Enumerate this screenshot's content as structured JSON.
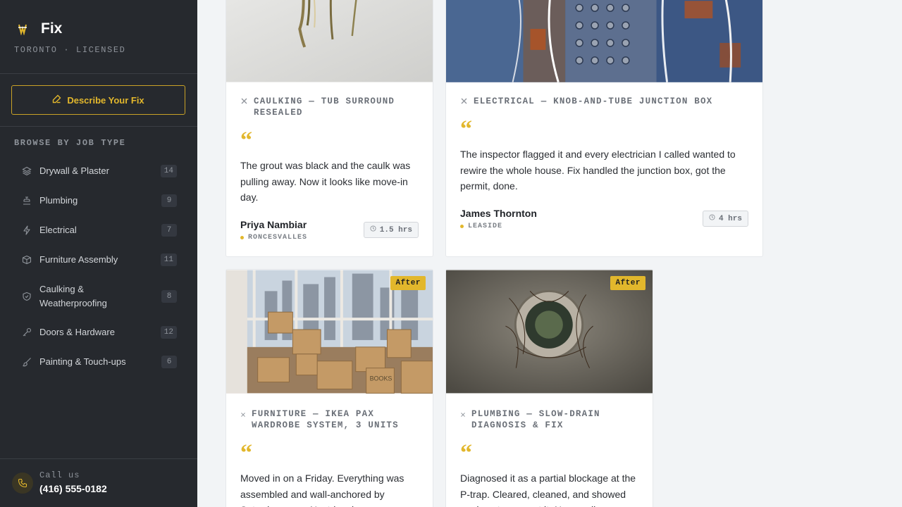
{
  "brand": {
    "name": "Fix",
    "subtitle": "TORONTO · LICENSED",
    "accent": "#e2b72c"
  },
  "cta": {
    "label": "Describe Your Fix",
    "icon": "edit-icon"
  },
  "nav": {
    "title": "BROWSE BY JOB TYPE",
    "items": [
      {
        "label": "Drywall & Plaster",
        "count": "14",
        "icon": "layers-icon"
      },
      {
        "label": "Plumbing",
        "count": "9",
        "icon": "faucet-icon"
      },
      {
        "label": "Electrical",
        "count": "7",
        "icon": "bolt-icon"
      },
      {
        "label": "Furniture Assembly",
        "count": "11",
        "icon": "box-icon"
      },
      {
        "label": "Caulking & Weatherproofing",
        "count": "8",
        "icon": "shield-icon"
      },
      {
        "label": "Doors & Hardware",
        "count": "12",
        "icon": "key-icon"
      },
      {
        "label": "Painting & Touch-ups",
        "count": "6",
        "icon": "brush-icon"
      }
    ]
  },
  "footer": {
    "call_label": "Call us",
    "phone": "(416) 555-0182"
  },
  "cards": [
    {
      "job": "CAULKING — TUB SURROUND RESEALED",
      "quote": "The grout was black and the caulk was pulling away. Now it looks like move-in day.",
      "author": "Priya Nambiar",
      "neighbourhood": "RONCESVALLES",
      "time": "1.5 hrs"
    },
    {
      "job": "ELECTRICAL — KNOB-AND-TUBE JUNCTION BOX",
      "quote": "The inspector flagged it and every electrician I called wanted to rewire the whole house. Fix handled the junction box, got the permit, done.",
      "author": "James Thornton",
      "neighbourhood": "LEASIDE",
      "time": "4 hrs"
    },
    {
      "badge": "After",
      "job": "FURNITURE — IKEA PAX WARDROBE SYSTEM, 3 UNITS",
      "quote": "Moved in on a Friday. Everything was assembled and wall-anchored by Saturday noon. Next-level",
      "box_label": "BOOKS"
    },
    {
      "badge": "After",
      "job": "PLUMBING — SLOW-DRAIN DIAGNOSIS & FIX",
      "quote": "Diagnosed it as a partial blockage at the P-trap. Cleared, cleaned, and showed me how to prevent it. No upsell."
    }
  ]
}
